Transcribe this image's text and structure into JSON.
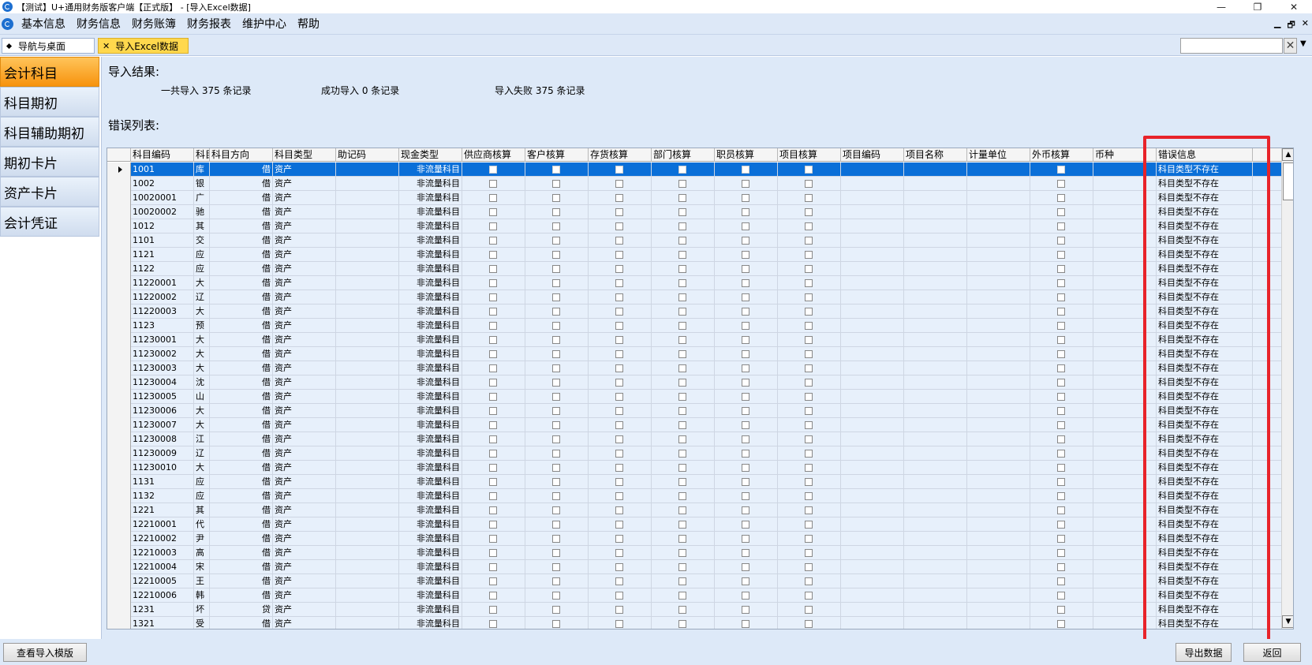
{
  "window": {
    "title": "【测试】U+通用财务版客户端【正式版】 - [导入Excel数据]",
    "minimize": "—",
    "restore": "❐",
    "close": "✕"
  },
  "menu": {
    "items": [
      "基本信息",
      "财务信息",
      "财务账簿",
      "财务报表",
      "维护中心",
      "帮助"
    ],
    "right_controls": [
      "▁",
      "🗗",
      "✕"
    ]
  },
  "tabs": {
    "home_label": "导航与桌面",
    "active_label": "导入Excel数据",
    "search_value": "",
    "clear_glyph": "✕",
    "menu_glyph": "▼"
  },
  "sidebar": {
    "items": [
      "会计科目",
      "科目期初",
      "科目辅助期初",
      "期初卡片",
      "资产卡片",
      "会计凭证"
    ],
    "active_index": 0
  },
  "results": {
    "heading": "导入结果:",
    "total": "一共导入 375 条记录",
    "success": "成功导入 0 条记录",
    "failed": "导入失败 375 条记录",
    "error_heading": "错误列表:"
  },
  "grid": {
    "columns": [
      "科目编码",
      "科目",
      "科目方向",
      "科目类型",
      "助记码",
      "现金类型",
      "供应商核算",
      "客户核算",
      "存货核算",
      "部门核算",
      "职员核算",
      "项目核算",
      "项目编码",
      "项目名称",
      "计量单位",
      "外币核算",
      "币种",
      "错误信息"
    ],
    "rows": [
      [
        "1001",
        "库",
        "借",
        "资产",
        "非流量科目",
        "科目类型不存在"
      ],
      [
        "1002",
        "银",
        "借",
        "资产",
        "非流量科目",
        "科目类型不存在"
      ],
      [
        "10020001",
        "广",
        "借",
        "资产",
        "非流量科目",
        "科目类型不存在"
      ],
      [
        "10020002",
        "驰",
        "借",
        "资产",
        "非流量科目",
        "科目类型不存在"
      ],
      [
        "1012",
        "其",
        "借",
        "资产",
        "非流量科目",
        "科目类型不存在"
      ],
      [
        "1101",
        "交",
        "借",
        "资产",
        "非流量科目",
        "科目类型不存在"
      ],
      [
        "1121",
        "应",
        "借",
        "资产",
        "非流量科目",
        "科目类型不存在"
      ],
      [
        "1122",
        "应",
        "借",
        "资产",
        "非流量科目",
        "科目类型不存在"
      ],
      [
        "11220001",
        "大",
        "借",
        "资产",
        "非流量科目",
        "科目类型不存在"
      ],
      [
        "11220002",
        "辽",
        "借",
        "资产",
        "非流量科目",
        "科目类型不存在"
      ],
      [
        "11220003",
        "大",
        "借",
        "资产",
        "非流量科目",
        "科目类型不存在"
      ],
      [
        "1123",
        "预",
        "借",
        "资产",
        "非流量科目",
        "科目类型不存在"
      ],
      [
        "11230001",
        "大",
        "借",
        "资产",
        "非流量科目",
        "科目类型不存在"
      ],
      [
        "11230002",
        "大",
        "借",
        "资产",
        "非流量科目",
        "科目类型不存在"
      ],
      [
        "11230003",
        "大",
        "借",
        "资产",
        "非流量科目",
        "科目类型不存在"
      ],
      [
        "11230004",
        "沈",
        "借",
        "资产",
        "非流量科目",
        "科目类型不存在"
      ],
      [
        "11230005",
        "山",
        "借",
        "资产",
        "非流量科目",
        "科目类型不存在"
      ],
      [
        "11230006",
        "大",
        "借",
        "资产",
        "非流量科目",
        "科目类型不存在"
      ],
      [
        "11230007",
        "大",
        "借",
        "资产",
        "非流量科目",
        "科目类型不存在"
      ],
      [
        "11230008",
        "江",
        "借",
        "资产",
        "非流量科目",
        "科目类型不存在"
      ],
      [
        "11230009",
        "辽",
        "借",
        "资产",
        "非流量科目",
        "科目类型不存在"
      ],
      [
        "11230010",
        "大",
        "借",
        "资产",
        "非流量科目",
        "科目类型不存在"
      ],
      [
        "1131",
        "应",
        "借",
        "资产",
        "非流量科目",
        "科目类型不存在"
      ],
      [
        "1132",
        "应",
        "借",
        "资产",
        "非流量科目",
        "科目类型不存在"
      ],
      [
        "1221",
        "其",
        "借",
        "资产",
        "非流量科目",
        "科目类型不存在"
      ],
      [
        "12210001",
        "代",
        "借",
        "资产",
        "非流量科目",
        "科目类型不存在"
      ],
      [
        "12210002",
        "尹",
        "借",
        "资产",
        "非流量科目",
        "科目类型不存在"
      ],
      [
        "12210003",
        "高",
        "借",
        "资产",
        "非流量科目",
        "科目类型不存在"
      ],
      [
        "12210004",
        "宋",
        "借",
        "资产",
        "非流量科目",
        "科目类型不存在"
      ],
      [
        "12210005",
        "王",
        "借",
        "资产",
        "非流量科目",
        "科目类型不存在"
      ],
      [
        "12210006",
        "韩",
        "借",
        "资产",
        "非流量科目",
        "科目类型不存在"
      ],
      [
        "1231",
        "坏",
        "贷",
        "资产",
        "非流量科目",
        "科目类型不存在"
      ],
      [
        "1321",
        "受",
        "借",
        "资产",
        "非流量科目",
        "科目类型不存在"
      ]
    ],
    "selected_row": 0
  },
  "scroll": {
    "up": "▲",
    "down": "▼"
  },
  "bottom": {
    "template_button": "查看导入模版",
    "export_button": "导出数据",
    "back_button": "返回"
  },
  "colors": {
    "selection": "#0a6fd8",
    "active_tab": "#ffd84d",
    "active_sidebar": "#f7930d",
    "highlight": "#e8232a"
  }
}
